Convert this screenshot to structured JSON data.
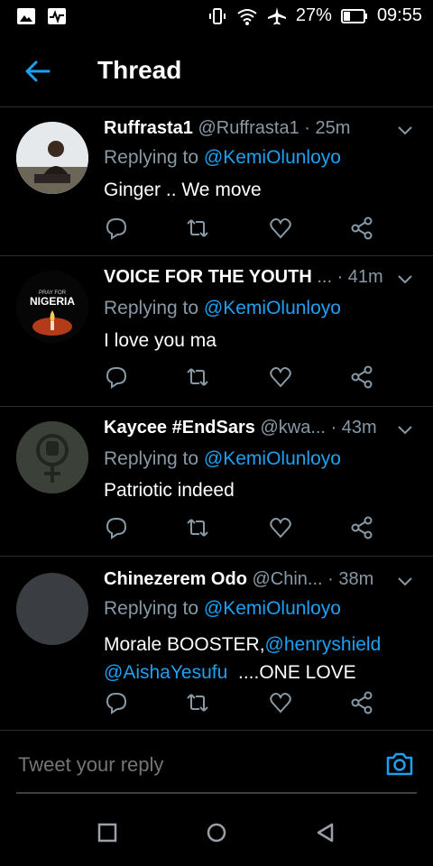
{
  "status_bar": {
    "battery": "27%",
    "time": "09:55"
  },
  "header": {
    "title": "Thread"
  },
  "tweets": [
    {
      "name": "Ruffrasta1",
      "handle": "@Ruffrasta1",
      "time": "· 25m",
      "replying_prefix": "Replying to ",
      "replying_to": "@KemiOlunloyo",
      "text": "Ginger .. We move"
    },
    {
      "name": "VOICE FOR THE YOUTH",
      "handle": "...",
      "time": "· 41m",
      "replying_prefix": "Replying to ",
      "replying_to": "@KemiOlunloyo",
      "text": "I love you ma",
      "avatar_text_top": "PRAY FOR",
      "avatar_text_main": "NIGERIA"
    },
    {
      "name": "Kaycee #EndSars",
      "handle": "@kwa...",
      "time": "· 43m",
      "replying_prefix": "Replying to ",
      "replying_to": "@KemiOlunloyo",
      "text": "Patriotic indeed"
    },
    {
      "name": "Chinezerem Odo",
      "handle": "@Chin...",
      "time": "· 38m",
      "replying_prefix": "Replying to ",
      "replying_to": "@KemiOlunloyo",
      "text_part1": "Morale BOOSTER,",
      "mention1": "@henryshield",
      "mention2": "@AishaYesufu",
      "text_part2": "  ....ONE LOVE"
    }
  ],
  "reply_bar": {
    "placeholder": "Tweet your reply"
  },
  "colors": {
    "accent": "#1da1f2",
    "muted": "#8899a6",
    "background": "#000000",
    "divider": "#2a2f33"
  }
}
